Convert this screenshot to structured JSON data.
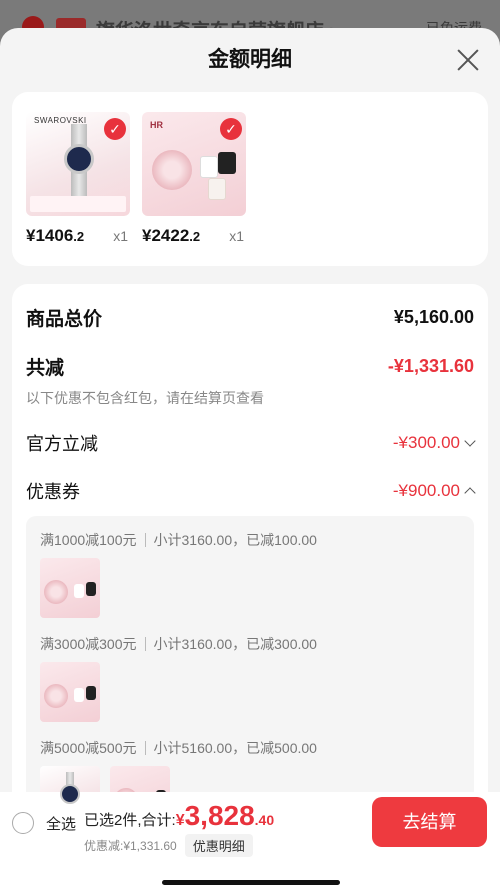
{
  "background_page": {
    "shop_title": "旗华洛世奇京东自营旗舰店 ›",
    "right_text": "已免运费"
  },
  "sheet": {
    "title": "金额明细"
  },
  "products": [
    {
      "brand": "SWAROVSKI",
      "price_int": "¥1406",
      "price_dec": ".2",
      "qty": "x1",
      "check_icon": "check-icon"
    },
    {
      "brand": "HR",
      "price_int": "¥2422",
      "price_dec": ".2",
      "qty": "x1",
      "check_icon": "check-icon"
    }
  ],
  "summary": {
    "goods_total_label": "商品总价",
    "goods_total": "¥5,160.00",
    "discount_label": "共减",
    "discount_total": "-¥1,331.60",
    "note": "以下优惠不包含红包，请在结算页查看",
    "official_label": "官方立减",
    "official_amount": "-¥300.00",
    "coupon_label": "优惠券",
    "coupon_amount": "-¥900.00"
  },
  "coupons": [
    {
      "rule": "满1000减100元",
      "detail": "小计3160.00，已减100.00"
    },
    {
      "rule": "满3000减300元",
      "detail": "小计3160.00，已减300.00"
    },
    {
      "rule": "满5000减500元",
      "detail": "小计5160.00，已减500.00"
    }
  ],
  "bottom_bar": {
    "select_all": "全选",
    "selected_text": "已选2件,合计:",
    "yen": "¥",
    "total_int": "3,828",
    "total_dec": ".40",
    "discount_text": "优惠减:¥1,331.60",
    "detail_chip": "优惠明细",
    "checkout": "去结算"
  },
  "colors": {
    "accent_red": "#e8323c",
    "checkout_bg": "#ee3a3f"
  }
}
